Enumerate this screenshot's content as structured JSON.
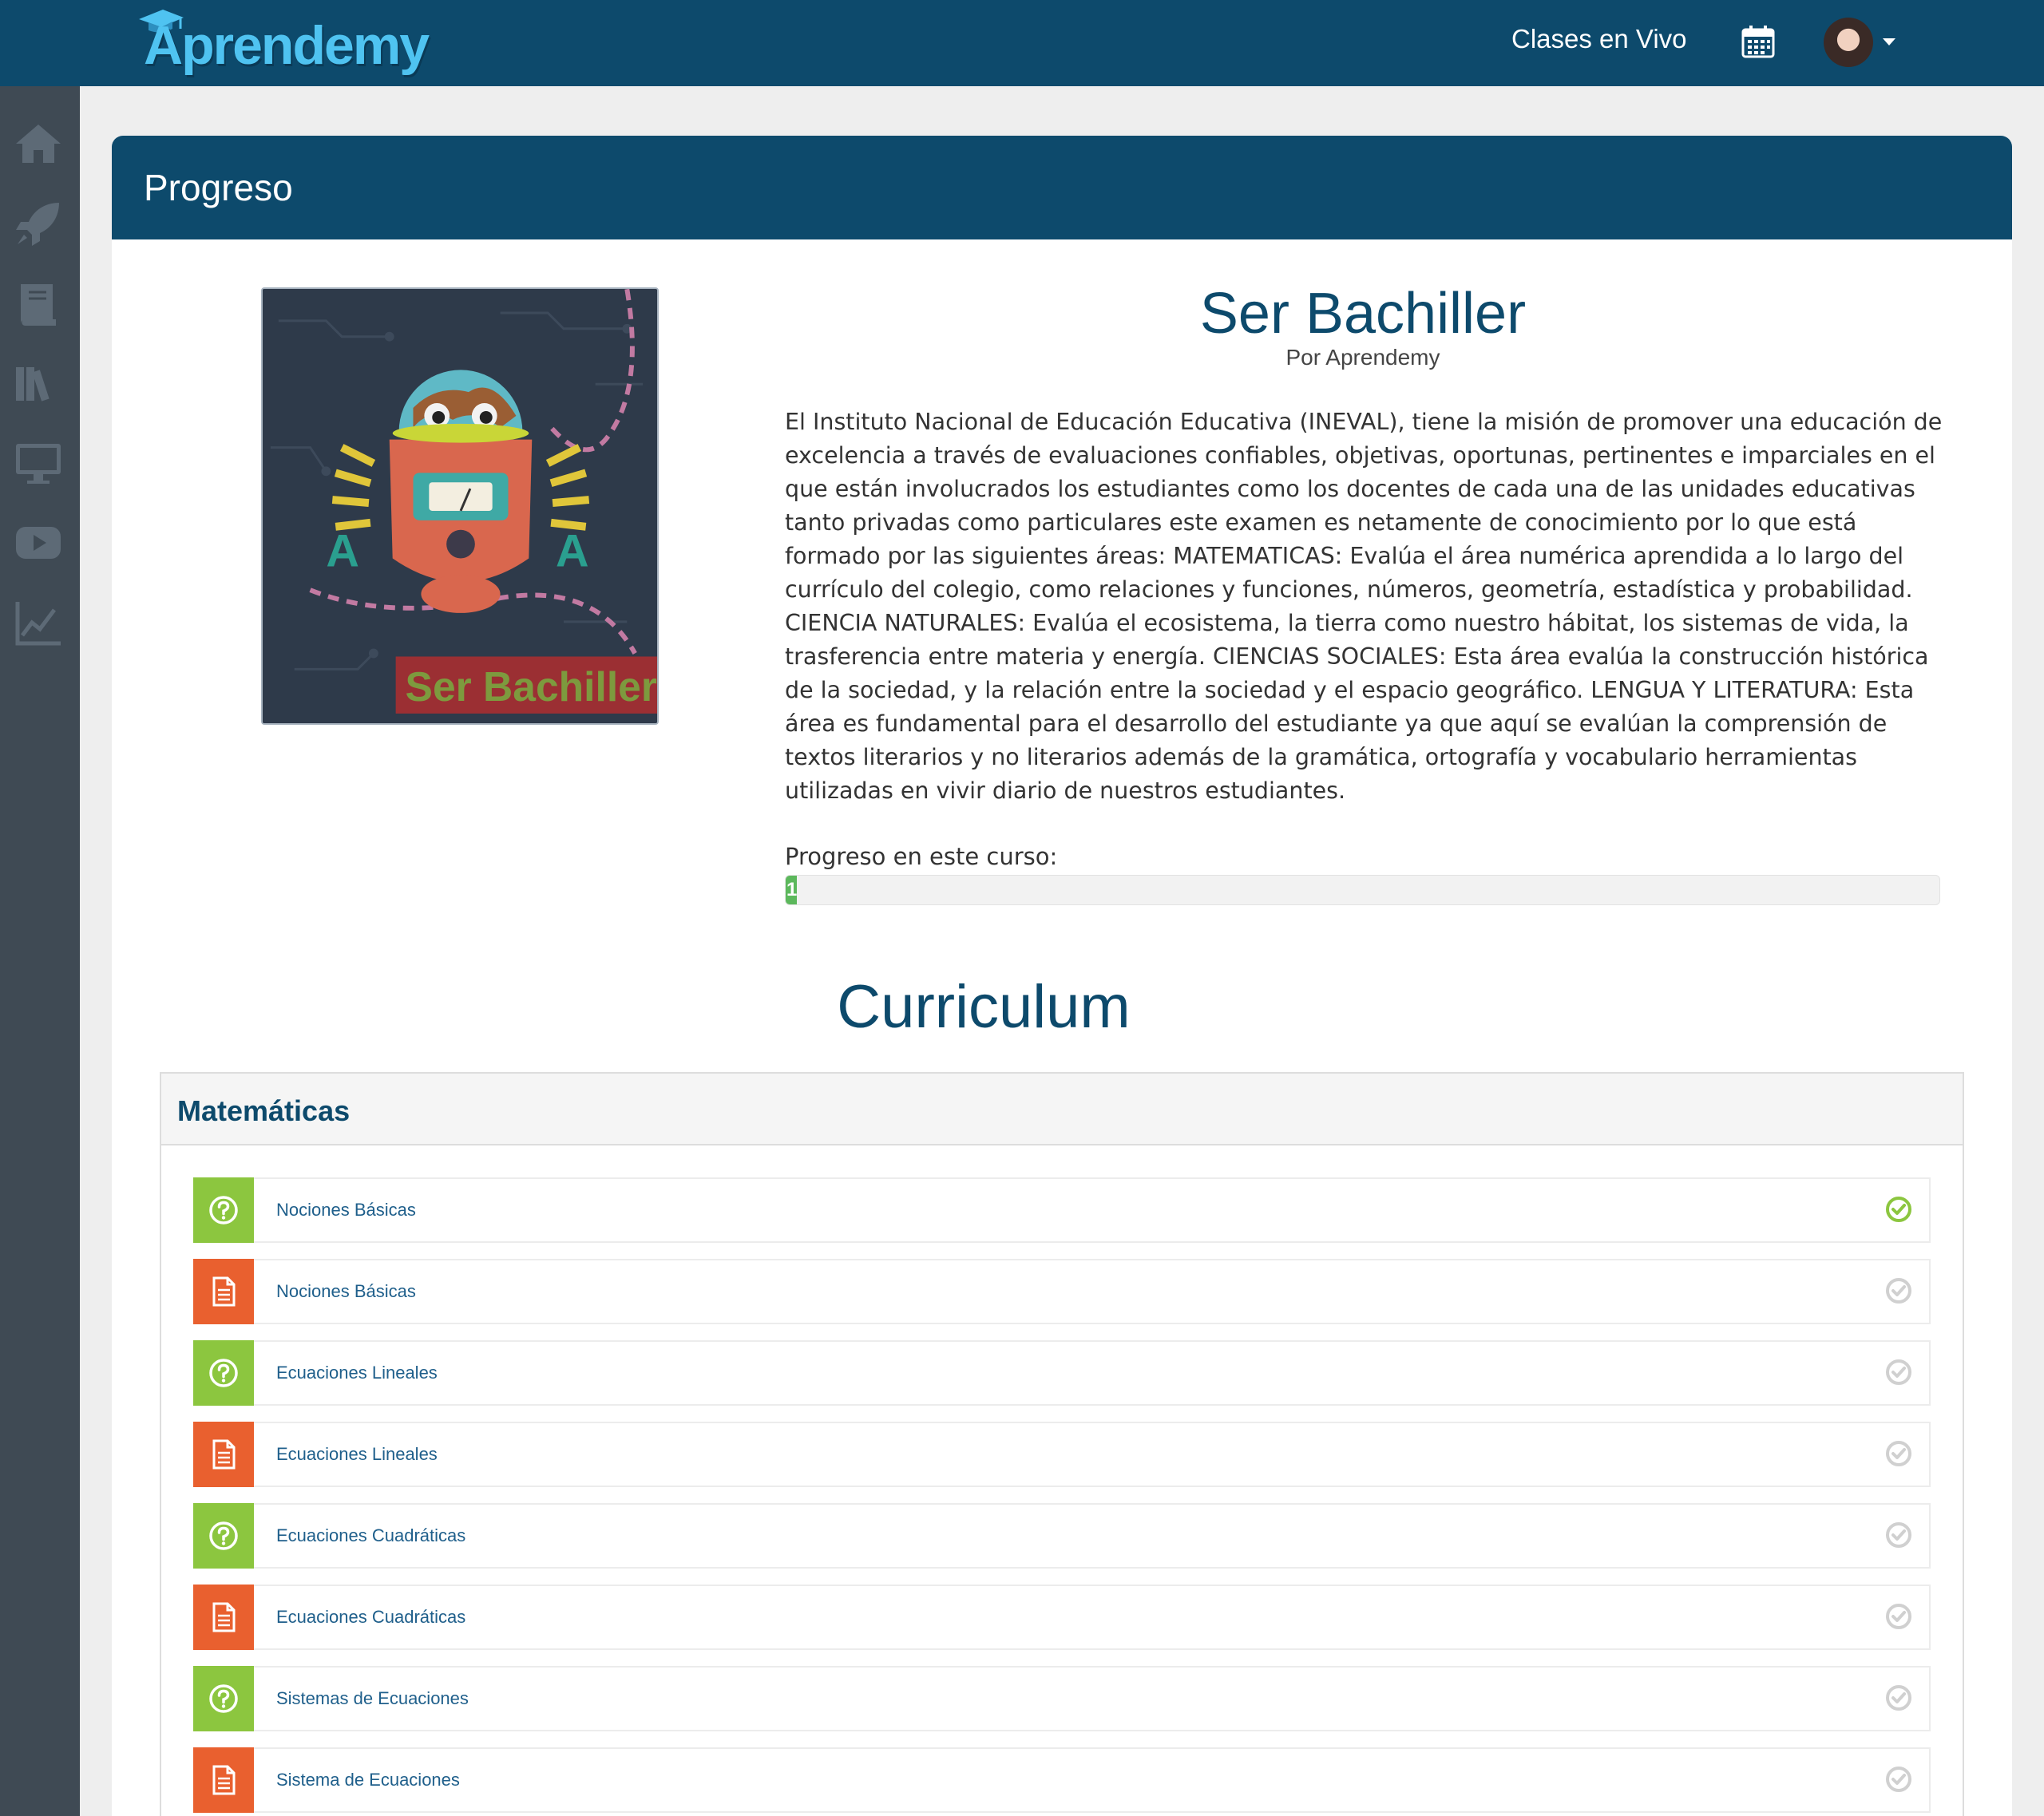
{
  "header": {
    "brand": "Aprendemy",
    "live_classes": "Clases en Vivo"
  },
  "colors": {
    "brand_dark": "#0d4a6c",
    "logo_blue": "#4fc3f1",
    "sidebar": "#3f4a54",
    "quiz_green": "#8cc63f",
    "doc_orange": "#e9602f",
    "progress_green": "#5cb85c"
  },
  "sidebar": {
    "items": [
      {
        "icon": "home-icon"
      },
      {
        "icon": "rocket-icon"
      },
      {
        "icon": "book-icon"
      },
      {
        "icon": "library-icon"
      },
      {
        "icon": "monitor-icon"
      },
      {
        "icon": "video-icon"
      },
      {
        "icon": "chart-icon"
      }
    ]
  },
  "page": {
    "title": "Progreso"
  },
  "course": {
    "title": "Ser Bachiller",
    "author": "Por Aprendemy",
    "image_caption": "Ser Bachiller",
    "image_letters": "A",
    "description": "El Instituto Nacional de Educación Educativa (INEVAL), tiene la misión de promover una educación de excelencia a través de evaluaciones confiables, objetivas, oportunas, pertinentes e imparciales en el que están involucrados los estudiantes como los docentes de cada una de las unidades educativas tanto privadas como particulares este examen es netamente de conocimiento por lo que está formado por las siguientes áreas: MATEMATICAS: Evalúa el área numérica aprendida a lo largo del currículo del colegio, como relaciones y funciones, números, geometría, estadística y probabilidad. CIENCIA NATURALES: Evalúa el ecosistema, la tierra como nuestro hábitat, los sistemas de vida, la trasferencia entre materia y energía. CIENCIAS SOCIALES: Esta área evalúa la construcción histórica de la sociedad, y la relación entre la sociedad y el espacio geográfico. LENGUA Y LITERATURA: Esta área es fundamental para el desarrollo del estudiante ya que aquí se evalúan la comprensión de textos literarios y no literarios además de la gramática, ortografía y vocabulario herramientas utilizadas en vivir diario de nuestros estudiantes.",
    "progress_label": "Progreso en este curso:",
    "progress_value": "1",
    "progress_percent": 1
  },
  "curriculum": {
    "title": "Curriculum",
    "section": "Matemáticas",
    "lessons": [
      {
        "type": "quiz",
        "label": "Nociones Básicas",
        "completed": true
      },
      {
        "type": "doc",
        "label": "Nociones Básicas",
        "completed": false
      },
      {
        "type": "quiz",
        "label": "Ecuaciones Lineales",
        "completed": false
      },
      {
        "type": "doc",
        "label": "Ecuaciones Lineales",
        "completed": false
      },
      {
        "type": "quiz",
        "label": "Ecuaciones Cuadráticas",
        "completed": false
      },
      {
        "type": "doc",
        "label": "Ecuaciones Cuadráticas",
        "completed": false
      },
      {
        "type": "quiz",
        "label": "Sistemas de Ecuaciones",
        "completed": false
      },
      {
        "type": "doc",
        "label": "Sistema de Ecuaciones",
        "completed": false
      }
    ]
  }
}
